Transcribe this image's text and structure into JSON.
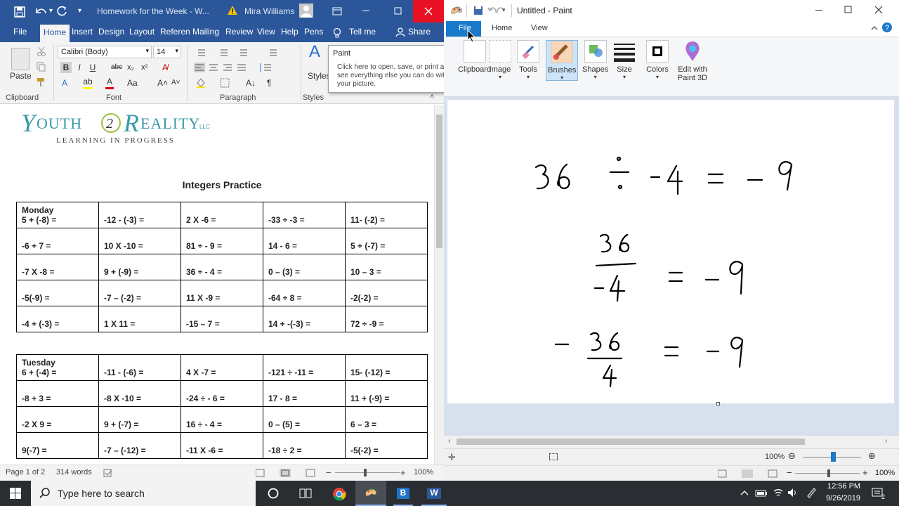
{
  "word": {
    "doc_title": "Homework for the Week - W...",
    "user": "Mira Williams",
    "tabs": [
      "File",
      "Home",
      "Insert",
      "Design",
      "Layout",
      "Referen",
      "Mailing",
      "Review",
      "View",
      "Help",
      "Pens"
    ],
    "tell_me": "Tell me",
    "share": "Share",
    "font_name": "Calibri (Body)",
    "font_size": "14",
    "paste_label": "Paste",
    "styles_label": "Styles",
    "groups": {
      "clipboard": "Clipboard",
      "font": "Font",
      "paragraph": "Paragraph",
      "styles": "Styles"
    },
    "logo": {
      "main": "Youth 2 Reality",
      "sup": "LLC",
      "sub": "LEARNING IN PROGRESS"
    },
    "doc_heading": "Integers Practice",
    "monday": {
      "day": "Monday",
      "rows": [
        [
          "5 + (-8) =",
          "-12 - (-3) =",
          "2 X -6 =",
          "-33 ÷ -3 =",
          "11- (-2) ="
        ],
        [
          "-6 + 7 =",
          "10 X -10 =",
          "81 ÷ - 9 =",
          "14 - 6 =",
          "5 + (-7) ="
        ],
        [
          "-7 X -8 =",
          "9 + (-9) =",
          "36 ÷ - 4 =",
          "0 – (3) =",
          "10 – 3 ="
        ],
        [
          "-5(-9) =",
          "-7 – (-2) =",
          "11 X -9 =",
          "-64 ÷ 8 =",
          "-2(-2) ="
        ],
        [
          "-4 + (-3) =",
          "1 X 11 =",
          "-15 – 7 =",
          "14 + -(-3) =",
          "72 ÷ -9 ="
        ]
      ]
    },
    "tuesday": {
      "day": "Tuesday",
      "rows": [
        [
          "6 + (-4) =",
          "-11 - (-6) =",
          "4 X -7 =",
          "-121 ÷ -11 =",
          "15- (-12) ="
        ],
        [
          "-8 + 3 =",
          "-8 X -10 =",
          "-24 ÷ - 6 =",
          "17 - 8 =",
          "11 + (-9) ="
        ],
        [
          "-2 X 9 =",
          "9 + (-7) =",
          "16 ÷ - 4 =",
          "0 – (5) =",
          "6 – 3 ="
        ],
        [
          "9(-7) =",
          "-7 – (-12) =",
          "-11 X -6 =",
          "-18 ÷ 2 =",
          "-5(-2) ="
        ]
      ]
    },
    "status": {
      "page": "Page 1 of 2",
      "words": "314 words",
      "zoom": "100%"
    }
  },
  "paint": {
    "title": "Untitled - Paint",
    "tabs": [
      "File",
      "Home",
      "View"
    ],
    "tools": [
      "Clipboard",
      "Image",
      "Tools",
      "Brushes",
      "Shapes",
      "Size",
      "Colors",
      "Edit with Paint 3D"
    ],
    "tooltip": {
      "title": "Paint",
      "body": "Click here to open, save, or print and to see everything else you can do with your picture."
    },
    "zoom": "100%",
    "canvas_lines": [
      "36 ÷ -4 = -9",
      "36/-4 = -9",
      "-36/4 = -9"
    ]
  },
  "taskbar": {
    "search_placeholder": "Type here to search",
    "time": "12:56 PM",
    "date": "9/26/2019",
    "notif_count": "2"
  },
  "colors": {
    "word_blue": "#2b579a",
    "word_close": "#e81123",
    "taskbar": "#2a2e33",
    "paint_canvas_bg": "#d7e1ee"
  }
}
